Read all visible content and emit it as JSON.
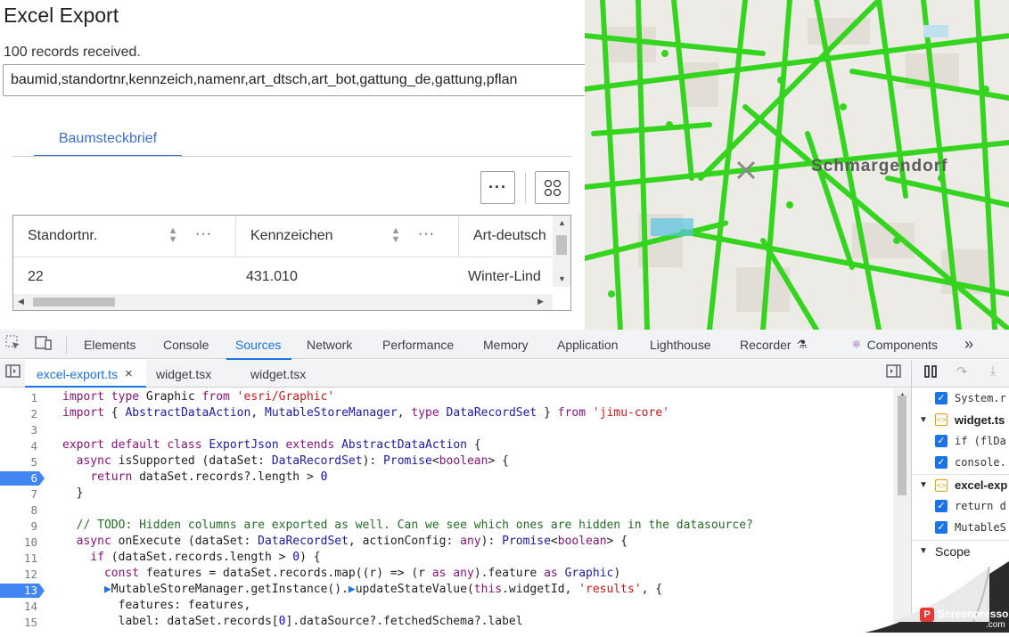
{
  "widget": {
    "title": "Excel Export",
    "record_count": "100 records received.",
    "csv_header": "baumid,standortnr,kennzeich,namenr,art_dtsch,art_bot,gattung_de,gattung,pflan",
    "tab_label": "Baumsteckbrief",
    "more_button": "···",
    "layout_icon": "grid-icon",
    "table": {
      "columns": [
        "Standortnr.",
        "Kennzeichen",
        "Art-deutsch"
      ],
      "rows": [
        [
          "22",
          "431.010",
          "Winter-Lind"
        ]
      ]
    }
  },
  "map": {
    "district_label": "Schmargendorf"
  },
  "devtools": {
    "tabs": [
      "Elements",
      "Console",
      "Sources",
      "Network",
      "Performance",
      "Memory",
      "Application",
      "Lighthouse",
      "Recorder",
      "Components"
    ],
    "active_tab": "Sources",
    "more_tabs": "»",
    "file_tabs": [
      {
        "name": "excel-export.ts",
        "active": true,
        "close": "×"
      },
      {
        "name": "widget.tsx",
        "active": false
      },
      {
        "name": "widget.tsx",
        "active": false
      }
    ],
    "code": [
      {
        "n": "1",
        "bp": false
      },
      {
        "n": "2",
        "bp": false
      },
      {
        "n": "3",
        "bp": false
      },
      {
        "n": "4",
        "bp": false
      },
      {
        "n": "5",
        "bp": false
      },
      {
        "n": "6",
        "bp": true
      },
      {
        "n": "7",
        "bp": false
      },
      {
        "n": "8",
        "bp": false
      },
      {
        "n": "9",
        "bp": false
      },
      {
        "n": "10",
        "bp": false
      },
      {
        "n": "11",
        "bp": false
      },
      {
        "n": "12",
        "bp": false
      },
      {
        "n": "13",
        "bp": true
      },
      {
        "n": "14",
        "bp": false
      },
      {
        "n": "15",
        "bp": false
      }
    ],
    "breakpoints": {
      "items": [
        {
          "text": "System.r",
          "kind": "entry"
        },
        {
          "text": "widget.ts",
          "kind": "file"
        },
        {
          "text": "if (flDa",
          "kind": "entry"
        },
        {
          "text": "console.",
          "kind": "entry"
        },
        {
          "text": "excel-exp",
          "kind": "file"
        },
        {
          "text": "return d",
          "kind": "entry"
        },
        {
          "text": "MutableS",
          "kind": "entry"
        }
      ],
      "scope_label": "Scope"
    }
  },
  "watermark": {
    "brand": "Screenpresso",
    "domain": ".com"
  },
  "colors": {
    "accent_blue": "#1a73e8",
    "tab_blue": "#3b6fd1",
    "tree_green": "#35d41f",
    "breakpoint_blue": "#4285f4"
  }
}
